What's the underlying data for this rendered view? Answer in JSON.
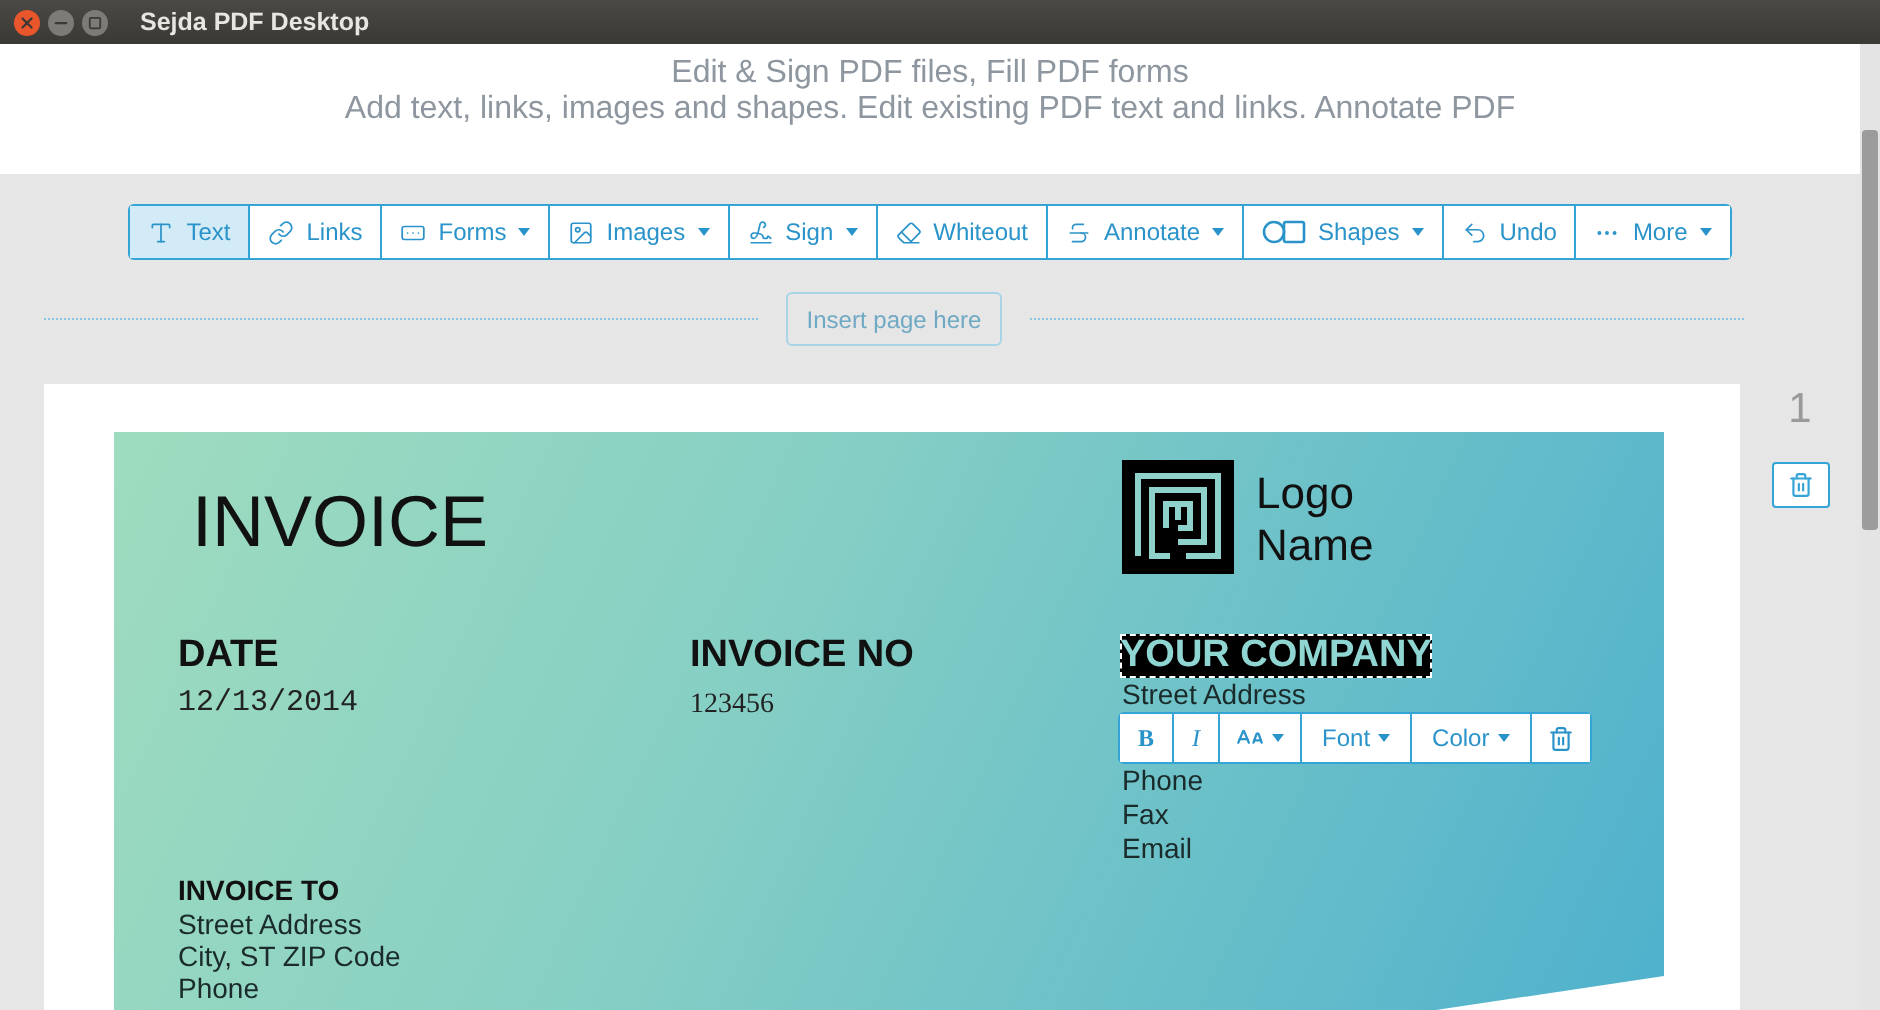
{
  "window": {
    "title": "Sejda PDF Desktop"
  },
  "header": {
    "lines": [
      "Edit & Sign PDF files, Fill PDF forms",
      "Add text, links, images and shapes. Edit existing PDF text and links. Annotate PDF"
    ]
  },
  "toolbar": [
    {
      "label": "Text",
      "selected": true,
      "dropdown": false
    },
    {
      "label": "Links",
      "selected": false,
      "dropdown": false
    },
    {
      "label": "Forms",
      "selected": false,
      "dropdown": true
    },
    {
      "label": "Images",
      "selected": false,
      "dropdown": true
    },
    {
      "label": "Sign",
      "selected": false,
      "dropdown": true
    },
    {
      "label": "Whiteout",
      "selected": false,
      "dropdown": false
    },
    {
      "label": "Annotate",
      "selected": false,
      "dropdown": true
    },
    {
      "label": "Shapes",
      "selected": false,
      "dropdown": true
    },
    {
      "label": "Undo",
      "selected": false,
      "dropdown": false
    },
    {
      "label": "More",
      "selected": false,
      "dropdown": true
    }
  ],
  "insert_page": {
    "label": "Insert page here"
  },
  "page": {
    "number": "1",
    "invoice": {
      "title": "INVOICE",
      "logo_name": [
        "Logo",
        "Name"
      ],
      "date": {
        "heading": "DATE",
        "value": "12/13/2014"
      },
      "invoice_no": {
        "heading": "INVOICE NO",
        "value": "123456"
      },
      "company": {
        "name": "YOUR COMPANY",
        "selected": true,
        "lines": [
          "Street Address",
          "Phone",
          "Fax",
          "Email"
        ]
      },
      "invoice_to": {
        "heading": "INVOICE TO",
        "lines": [
          "Street Address",
          "City, ST ZIP Code",
          "Phone"
        ]
      }
    },
    "text_toolbar": [
      {
        "kind": "bold",
        "label": "B"
      },
      {
        "kind": "italic",
        "label": "I"
      },
      {
        "kind": "size"
      },
      {
        "kind": "menu",
        "label": "Font"
      },
      {
        "kind": "menu",
        "label": "Color"
      },
      {
        "kind": "delete"
      }
    ]
  }
}
